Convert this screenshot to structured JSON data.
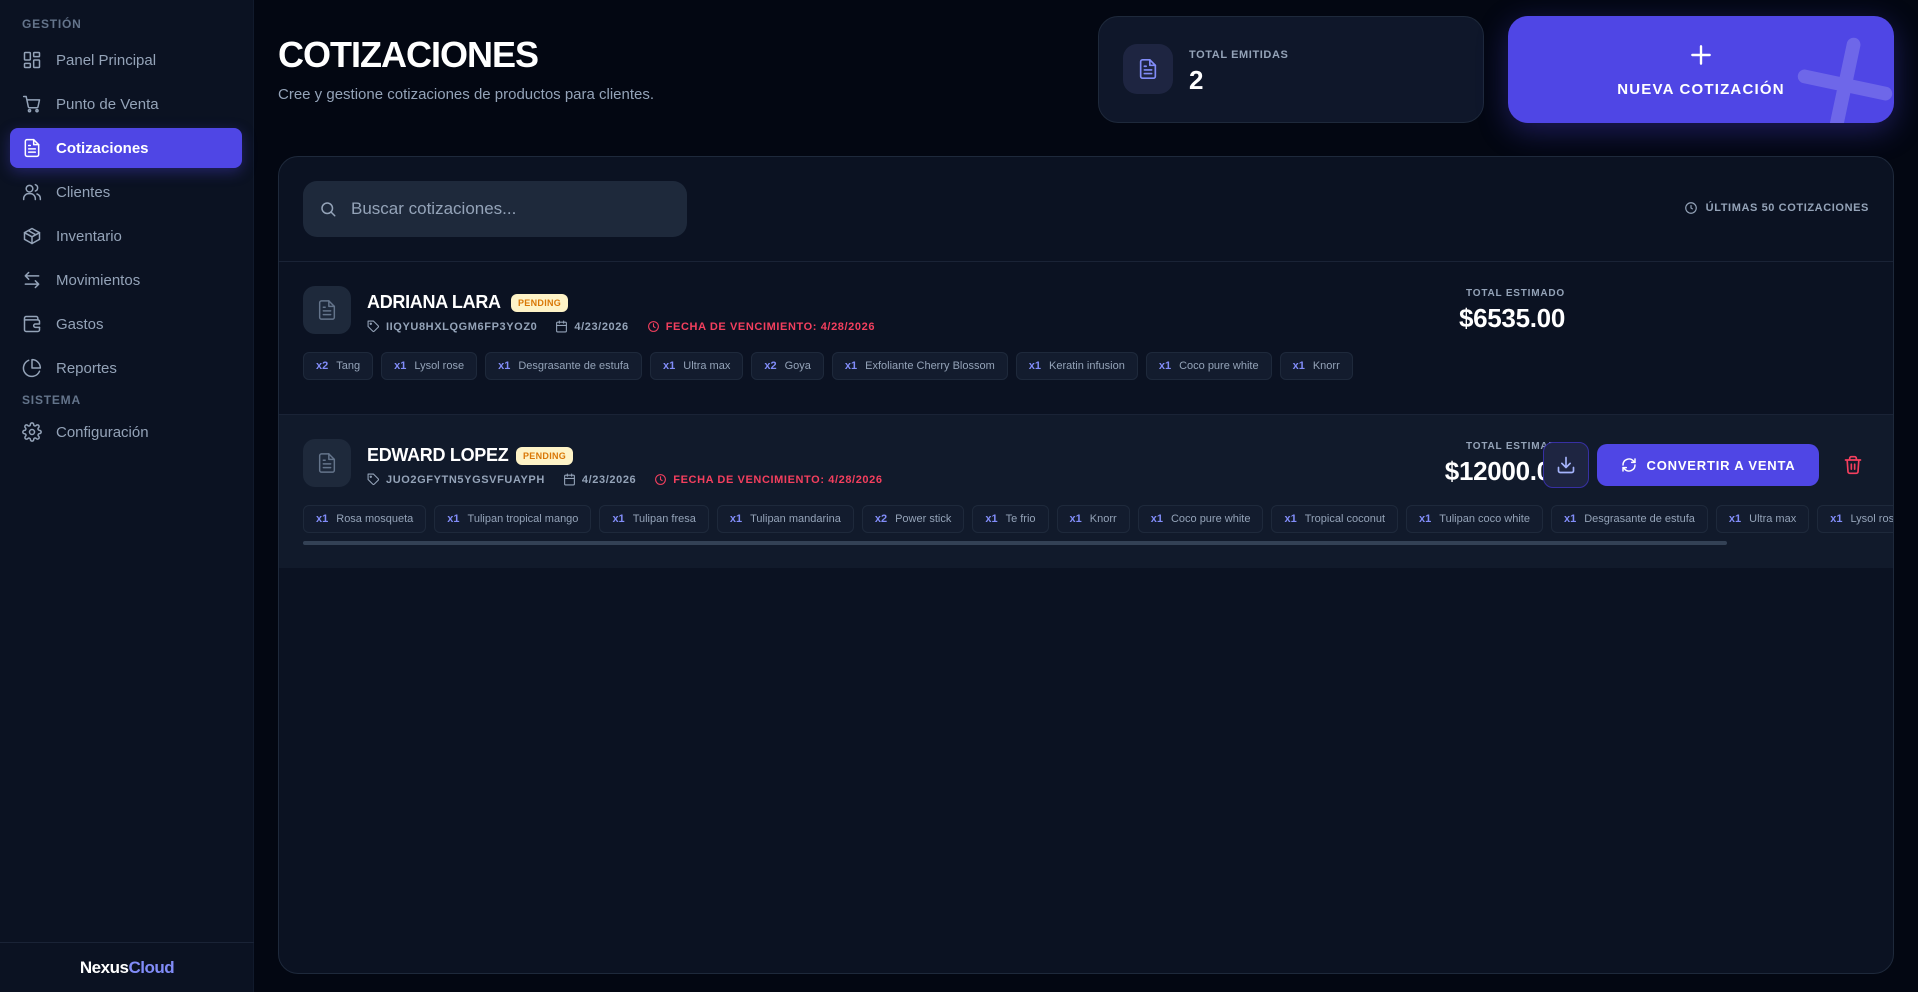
{
  "sidebar": {
    "section_gestion": "GESTIÓN",
    "section_sistema": "SISTEMA",
    "items": [
      {
        "label": "Panel Principal",
        "icon": "grid-icon"
      },
      {
        "label": "Punto de Venta",
        "icon": "cart-icon"
      },
      {
        "label": "Cotizaciones",
        "icon": "document-icon",
        "active": true
      },
      {
        "label": "Clientes",
        "icon": "users-icon"
      },
      {
        "label": "Inventario",
        "icon": "box-icon"
      },
      {
        "label": "Movimientos",
        "icon": "arrows-icon"
      },
      {
        "label": "Gastos",
        "icon": "wallet-icon"
      },
      {
        "label": "Reportes",
        "icon": "pie-chart-icon"
      }
    ],
    "system_items": [
      {
        "label": "Configuración",
        "icon": "gear-icon"
      }
    ],
    "brand_part1": "Nexus",
    "brand_part2": "Cloud"
  },
  "header": {
    "title": "COTIZACIONES",
    "subtitle": "Cree y gestione cotizaciones de productos para clientes.",
    "stat_label": "TOTAL EMITIDAS",
    "stat_value": "2",
    "new_button_label": "NUEVA COTIZACIÓN"
  },
  "search": {
    "placeholder": "Buscar cotizaciones...",
    "value": ""
  },
  "recent_note": "ÚLTIMAS 50 COTIZACIONES",
  "quotes": [
    {
      "client": "ADRIANA LARA",
      "status": "PENDING",
      "code": "IIQYU8HXLQGM6FP3YOZ0",
      "date": "4/23/2026",
      "due": "FECHA DE VENCIMIENTO: 4/28/2026",
      "total_label": "TOTAL ESTIMADO",
      "total": "$6535.00",
      "items": [
        {
          "qty": "x2",
          "name": "Tang"
        },
        {
          "qty": "x1",
          "name": "Lysol rose"
        },
        {
          "qty": "x1",
          "name": "Desgrasante de estufa"
        },
        {
          "qty": "x1",
          "name": "Ultra max"
        },
        {
          "qty": "x2",
          "name": "Goya"
        },
        {
          "qty": "x1",
          "name": "Exfoliante Cherry Blossom"
        },
        {
          "qty": "x1",
          "name": "Keratin infusion"
        },
        {
          "qty": "x1",
          "name": "Coco pure white"
        },
        {
          "qty": "x1",
          "name": "Knorr"
        }
      ]
    },
    {
      "client": "EDWARD LOPEZ",
      "status": "PENDING",
      "code": "JUO2GFYTN5YGSVFUAYPH",
      "date": "4/23/2026",
      "due": "FECHA DE VENCIMIENTO: 4/28/2026",
      "total_label": "TOTAL ESTIMADO",
      "total": "$12000.00",
      "convert_label": "CONVERTIR A VENTA",
      "items": [
        {
          "qty": "x1",
          "name": "Rosa mosqueta"
        },
        {
          "qty": "x1",
          "name": "Tulipan tropical mango"
        },
        {
          "qty": "x1",
          "name": "Tulipan fresa"
        },
        {
          "qty": "x1",
          "name": "Tulipan mandarina"
        },
        {
          "qty": "x2",
          "name": "Power stick"
        },
        {
          "qty": "x1",
          "name": "Te frio"
        },
        {
          "qty": "x1",
          "name": "Knorr"
        },
        {
          "qty": "x1",
          "name": "Coco pure white"
        },
        {
          "qty": "x1",
          "name": "Tropical coconut"
        },
        {
          "qty": "x1",
          "name": "Tulipan coco white"
        },
        {
          "qty": "x1",
          "name": "Desgrasante de estufa"
        },
        {
          "qty": "x1",
          "name": "Ultra max"
        },
        {
          "qty": "x1",
          "name": "Lysol rose"
        }
      ]
    }
  ],
  "colors": {
    "accent": "#4f46e5",
    "background": "#030712",
    "panel": "#0b1222",
    "danger": "#f43f5e",
    "pending_bg": "#fef3c7",
    "pending_text": "#d97706"
  }
}
